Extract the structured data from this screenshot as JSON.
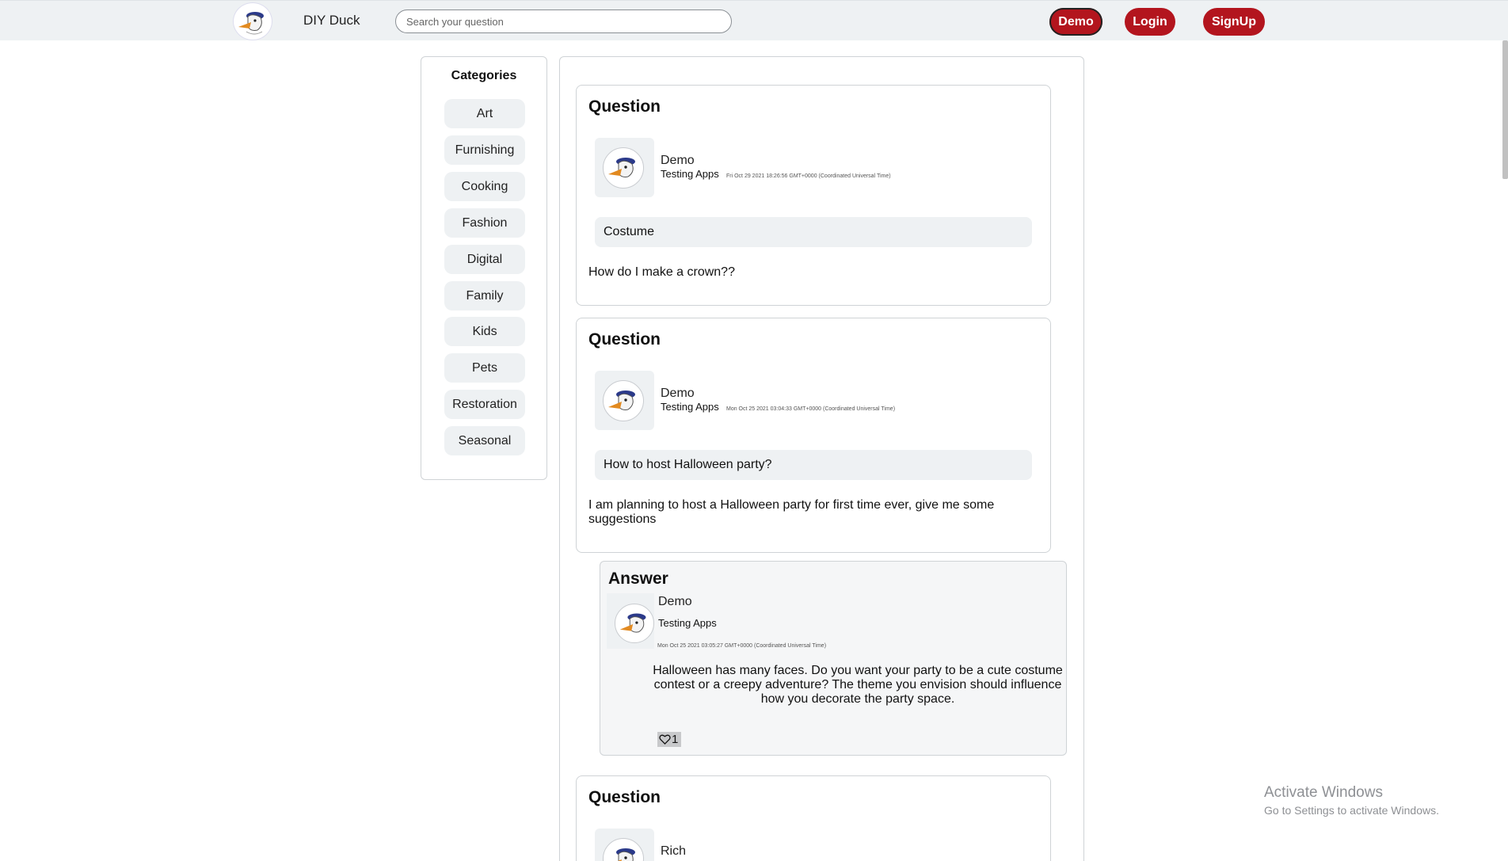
{
  "header": {
    "brand": "DIY Duck",
    "search_placeholder": "Search your question",
    "buttons": {
      "demo": "Demo",
      "login": "Login",
      "signup": "SignUp"
    },
    "accent_color": "#b3151e"
  },
  "sidebar": {
    "title": "Categories",
    "items": [
      "Art",
      "Furnishing",
      "Cooking",
      "Fashion",
      "Digital",
      "Family",
      "Kids",
      "Pets",
      "Restoration",
      "Seasonal"
    ]
  },
  "feed": {
    "questions": [
      {
        "heading": "Question",
        "user": "Demo",
        "subtitle": "Testing Apps",
        "date": "Fri Oct 29 2021 18:26:56 GMT+0000 (Coordinated Universal Time)",
        "category": "Costume",
        "body": "How do I make a crown??"
      },
      {
        "heading": "Question",
        "user": "Demo",
        "subtitle": "Testing Apps",
        "date": "Mon Oct 25 2021 03:04:33 GMT+0000 (Coordinated Universal Time)",
        "category": "How to host Halloween party?",
        "body": "I am planning to host a Halloween party for first time ever, give me some suggestions"
      },
      {
        "heading": "Question",
        "user": "Rich"
      }
    ],
    "answer": {
      "heading": "Answer",
      "user": "Demo",
      "subtitle": "Testing Apps",
      "date": "Mon Oct 25 2021 03:05:27 GMT+0000 (Coordinated Universal Time)",
      "body": "Halloween has many faces. Do you want your party to be a cute costume contest or a creepy adventure? The theme you envision should influence how you decorate the party space.",
      "likes": "1"
    }
  },
  "watermark": {
    "line1": "Activate Windows",
    "line2": "Go to Settings to activate Windows."
  }
}
